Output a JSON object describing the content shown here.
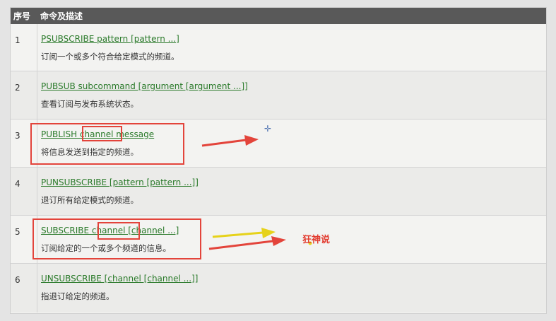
{
  "header": {
    "col_num": "序号",
    "col_desc": "命令及描述"
  },
  "rows": [
    {
      "num": "1",
      "command": "PSUBSCRIBE pattern [pattern ...]",
      "description": "订阅一个或多个符合给定模式的频道。"
    },
    {
      "num": "2",
      "command": "PUBSUB subcommand [argument [argument ...]]",
      "description": "查看订阅与发布系统状态。"
    },
    {
      "num": "3",
      "command": "PUBLISH channel message",
      "description": "将信息发送到指定的频道。"
    },
    {
      "num": "4",
      "command": "PUNSUBSCRIBE [pattern [pattern ...]]",
      "description": "退订所有给定模式的频道。"
    },
    {
      "num": "5",
      "command": "SUBSCRIBE channel [channel ...]",
      "description": "订阅给定的一个或多个频道的信息。"
    },
    {
      "num": "6",
      "command": "UNSUBSCRIBE [channel [channel ...]]",
      "description": "指退订给定的频道。"
    }
  ],
  "annotation": {
    "text": "狂神说"
  },
  "colors": {
    "header_bg": "#595959",
    "link": "#2a7a2a",
    "annotation_red": "#e3443b",
    "annotation_yellow": "#e6d21a"
  }
}
